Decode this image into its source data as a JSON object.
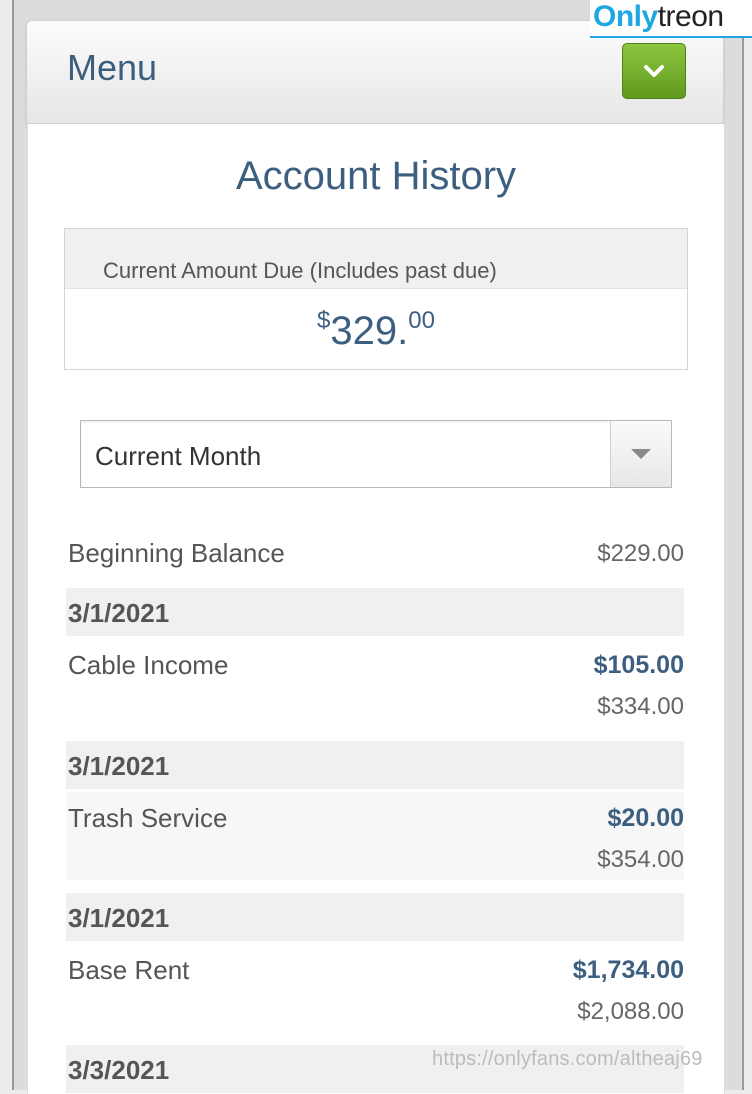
{
  "menu": {
    "title": "Menu",
    "toggle_icon": "chevron-down-icon",
    "toggle_color": "#6fab2a"
  },
  "page": {
    "title": "Account History",
    "title_color": "#3c5f80"
  },
  "amount_due": {
    "label": "Current Amount Due (Includes past due)",
    "currency": "$",
    "whole": "329.",
    "cents": "00"
  },
  "period_select": {
    "value": "Current Month",
    "icon": "caret-down-icon"
  },
  "ledger": {
    "beginning": {
      "label": "Beginning Balance",
      "amount": "$229.00"
    },
    "entries": [
      {
        "date": "3/1/2021",
        "description": "Cable Income",
        "amount": "$105.00",
        "balance": "$334.00"
      },
      {
        "date": "3/1/2021",
        "description": "Trash Service",
        "amount": "$20.00",
        "balance": "$354.00"
      },
      {
        "date": "3/1/2021",
        "description": "Base Rent",
        "amount": "$1,734.00",
        "balance": "$2,088.00"
      },
      {
        "date": "3/3/2021"
      }
    ]
  },
  "overlay": {
    "logo_part1": "Only",
    "logo_part2": "treon",
    "watermark_url": "https://onlyfans.com/altheaj69"
  }
}
